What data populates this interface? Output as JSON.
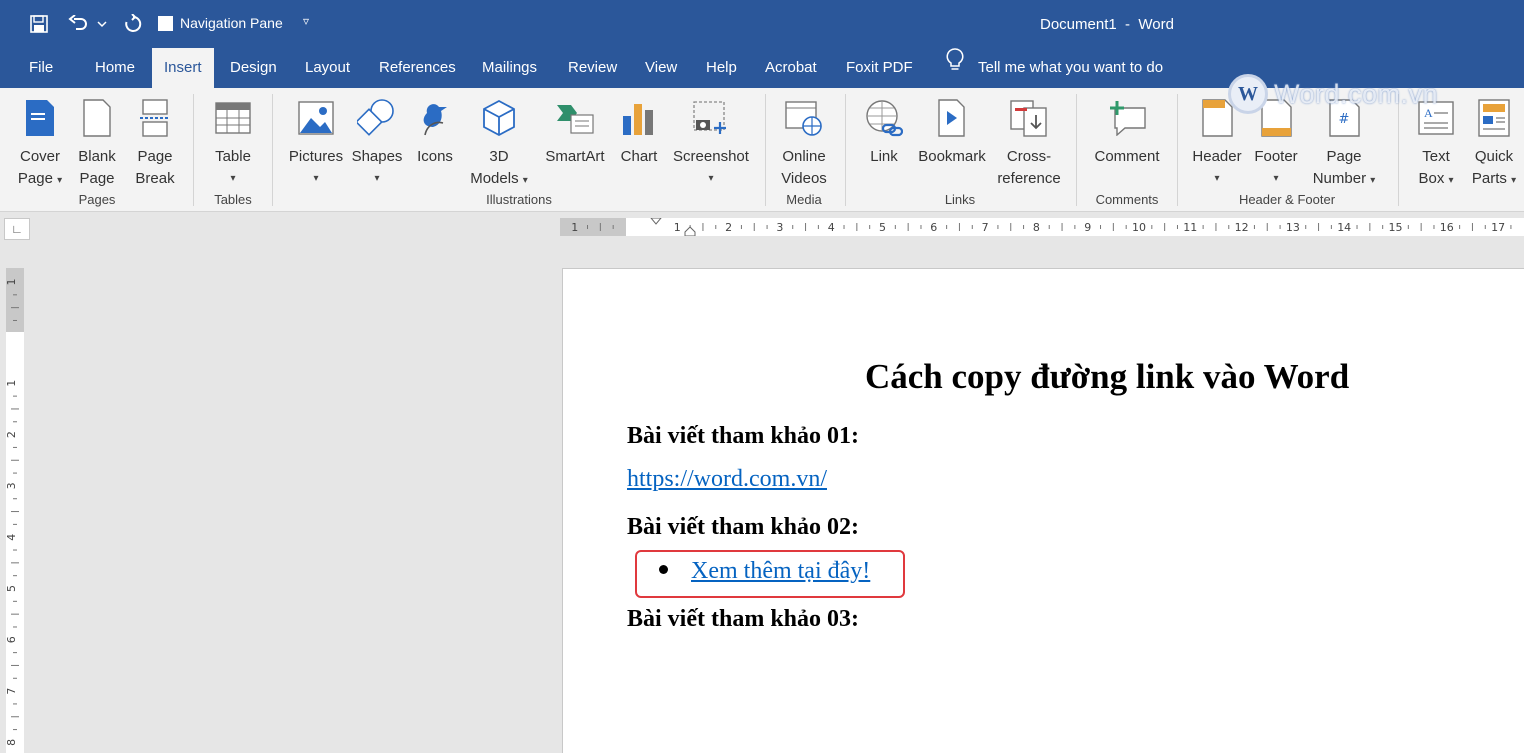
{
  "titlebar": {
    "navigation_pane_label": "Navigation Pane",
    "document_title": "Document1  -  Word"
  },
  "tabs": [
    {
      "label": "File"
    },
    {
      "label": "Home"
    },
    {
      "label": "Insert"
    },
    {
      "label": "Design"
    },
    {
      "label": "Layout"
    },
    {
      "label": "References"
    },
    {
      "label": "Mailings"
    },
    {
      "label": "Review"
    },
    {
      "label": "View"
    },
    {
      "label": "Help"
    },
    {
      "label": "Acrobat"
    },
    {
      "label": "Foxit PDF"
    }
  ],
  "active_tab": "Insert",
  "tell_me": "Tell me what you want to do",
  "watermark": {
    "logo_letter": "W",
    "text": "Word.com.vn"
  },
  "ribbon": {
    "buttons": [
      {
        "line1": "Cover",
        "line2": "Page",
        "icon": "cover-page-icon"
      },
      {
        "line1": "Blank",
        "line2": "Page",
        "icon": "blank-page-icon"
      },
      {
        "line1": "Page",
        "line2": "Break",
        "icon": "page-break-icon"
      },
      {
        "line1": "Table",
        "line2": "",
        "icon": "table-icon"
      },
      {
        "line1": "Pictures",
        "line2": "",
        "icon": "pictures-icon"
      },
      {
        "line1": "Shapes",
        "line2": "",
        "icon": "shapes-icon"
      },
      {
        "line1": "Icons",
        "line2": "",
        "icon": "icons-icon"
      },
      {
        "line1": "3D",
        "line2": "Models",
        "icon": "3d-models-icon"
      },
      {
        "line1": "SmartArt",
        "line2": "",
        "icon": "smartart-icon"
      },
      {
        "line1": "Chart",
        "line2": "",
        "icon": "chart-icon"
      },
      {
        "line1": "Screenshot",
        "line2": "",
        "icon": "screenshot-icon"
      },
      {
        "line1": "Online",
        "line2": "Videos",
        "icon": "online-videos-icon"
      },
      {
        "line1": "Link",
        "line2": "",
        "icon": "link-icon"
      },
      {
        "line1": "Bookmark",
        "line2": "",
        "icon": "bookmark-icon"
      },
      {
        "line1": "Cross-",
        "line2": "reference",
        "icon": "cross-reference-icon"
      },
      {
        "line1": "Comment",
        "line2": "",
        "icon": "comment-icon"
      },
      {
        "line1": "Header",
        "line2": "",
        "icon": "header-icon"
      },
      {
        "line1": "Footer",
        "line2": "",
        "icon": "footer-icon"
      },
      {
        "line1": "Page",
        "line2": "Number",
        "icon": "page-number-icon"
      },
      {
        "line1": "Text",
        "line2": "Box",
        "icon": "text-box-icon"
      },
      {
        "line1": "Quick",
        "line2": "Parts",
        "icon": "quick-parts-icon"
      }
    ],
    "groups": [
      "Pages",
      "Tables",
      "Illustrations",
      "Media",
      "Links",
      "Comments",
      "Header & Footer"
    ]
  },
  "ruler": {
    "h_ticks": [
      "1",
      "1",
      "2",
      "3",
      "4",
      "5",
      "6",
      "7",
      "8",
      "9",
      "10",
      "11",
      "12",
      "13",
      "14",
      "15",
      "16",
      "17"
    ],
    "v_ticks": [
      "1",
      "1",
      "2",
      "3",
      "4",
      "5",
      "6",
      "7",
      "8"
    ]
  },
  "document": {
    "heading": "Cách copy đường link vào Word",
    "ref1_label": "Bài viết tham khảo 01:",
    "ref1_link": "https://word.com.vn/",
    "ref2_label": "Bài viết tham khảo 02:",
    "ref2_link": "Xem thêm tại đây!",
    "ref3_label": "Bài viết tham khảo 03:"
  },
  "colors": {
    "brand": "#2b579a",
    "link": "#0563c1",
    "highlight": "#e0393e"
  }
}
